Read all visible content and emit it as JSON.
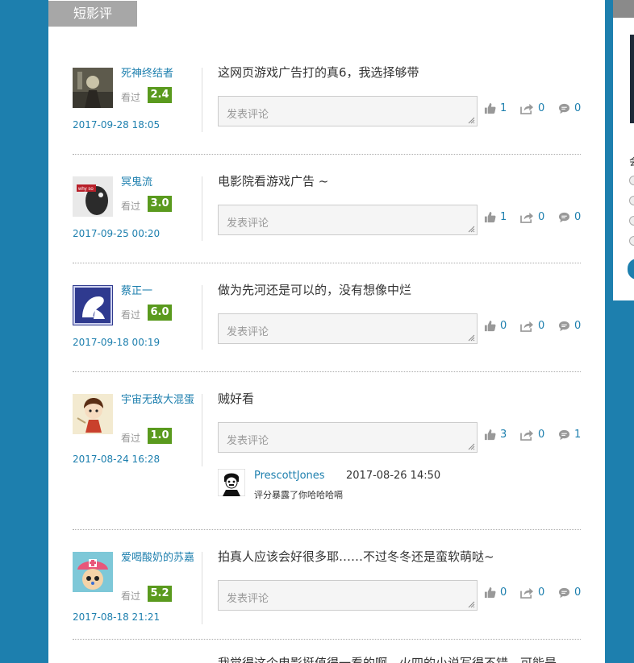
{
  "section_title": "短影评",
  "comment_placeholder": "发表评论",
  "seen_label": "看过",
  "side_label": "会",
  "colors": {
    "accent": "#1d7fae",
    "score_bg": "#5a9a1e",
    "header_bg": "#a7a7a7"
  },
  "reviews": [
    {
      "user": "死神终结者",
      "score": "2.4",
      "date": "2017-09-28 18:05",
      "text": "这网页游戏广告打的真6，我选择够带",
      "likes": "1",
      "shares": "0",
      "comments": "0"
    },
    {
      "user": "冥鬼流",
      "score": "3.0",
      "date": "2017-09-25 00:20",
      "text": "电影院看游戏广告 ~",
      "likes": "1",
      "shares": "0",
      "comments": "0"
    },
    {
      "user": "蔡正一",
      "score": "6.0",
      "date": "2017-09-18 00:19",
      "text": "做为先河还是可以的，没有想像中烂",
      "likes": "0",
      "shares": "0",
      "comments": "0"
    },
    {
      "user": "宇宙无敌大混蛋",
      "score": "1.0",
      "date": "2017-08-24 16:28",
      "text": "贼好看",
      "likes": "3",
      "shares": "0",
      "comments": "1",
      "reply": {
        "user": "PrescottJones",
        "date": "2017-08-26 14:50",
        "text": "评分暴露了你哈哈哈嗝"
      }
    },
    {
      "user": "爱喝酸奶的苏嘉",
      "score": "5.2",
      "date": "2017-08-18 21:21",
      "text": "拍真人应该会好很多耶……不过冬冬还是蛮软萌哒~",
      "likes": "0",
      "shares": "0",
      "comments": "0"
    },
    {
      "user": "",
      "score": "",
      "date": "",
      "text": "我觉得这个电影挺值得一看的啊，火四的小说写得不错，可能是",
      "likes": "",
      "shares": "",
      "comments": ""
    }
  ]
}
